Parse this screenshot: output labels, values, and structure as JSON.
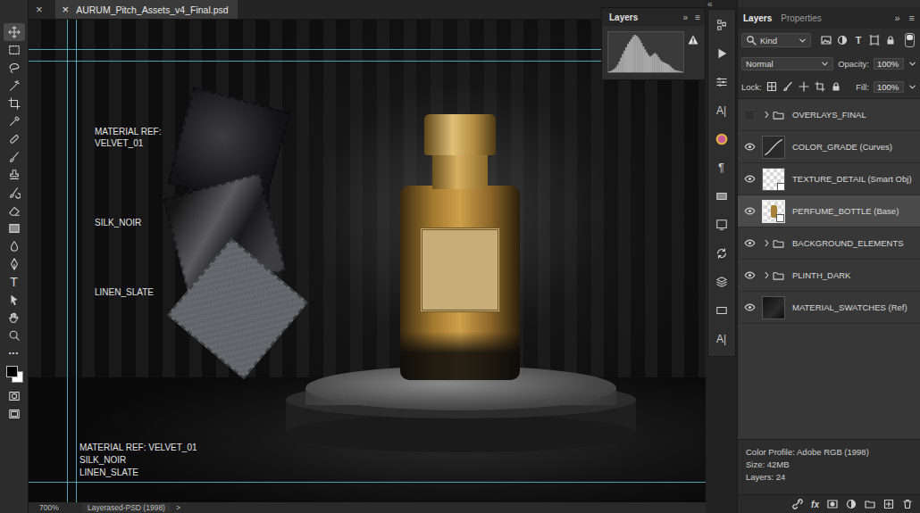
{
  "window": {
    "collapse_left": "«",
    "collapse_right": "»"
  },
  "document_tabs": [
    {
      "label": "",
      "close": "×",
      "selected": false
    },
    {
      "label": "AURUM_Pitch_Assets_v4_Final.psd",
      "close": "×",
      "selected": true
    }
  ],
  "tools": [
    {
      "selected": true,
      "glyph": ""
    },
    {
      "selected": false,
      "glyph": ""
    },
    {
      "selected": false,
      "glyph": ""
    },
    {
      "selected": false,
      "glyph": ""
    },
    {
      "selected": false,
      "glyph": ""
    },
    {
      "selected": false,
      "glyph": ""
    },
    {
      "selected": false,
      "glyph": ""
    },
    {
      "selected": false,
      "glyph": ""
    },
    {
      "selected": false,
      "glyph": ""
    },
    {
      "selected": false,
      "glyph": ""
    },
    {
      "selected": false,
      "glyph": ""
    },
    {
      "selected": false,
      "glyph": ""
    },
    {
      "selected": false,
      "glyph": ""
    },
    {
      "selected": false,
      "glyph": ""
    },
    {
      "selected": false,
      "glyph": "T"
    },
    {
      "selected": false,
      "glyph": ""
    },
    {
      "selected": false,
      "glyph": ""
    },
    {
      "selected": false,
      "glyph": ""
    },
    {
      "selected": false,
      "glyph": "•••"
    },
    {
      "selected": false,
      "glyph": ""
    },
    {
      "selected": false,
      "glyph": ""
    },
    {
      "selected": false,
      "glyph": ""
    }
  ],
  "canvas_labels": [
    {
      "lines": [
        "MATERIAL REF:",
        "VELVET_01"
      ]
    },
    {
      "lines": [
        "SILK_NOIR"
      ]
    },
    {
      "lines": [
        "LINEN_SLATE"
      ]
    }
  ],
  "canvas_note": {
    "lines": [
      "MATERIAL REF: VELVET_01",
      "SILK_NOIR",
      "LINEN_SLATE"
    ]
  },
  "status_bar": {
    "zoom": "700%",
    "info": "Layerased-PSD (1998)",
    "arrow": ">"
  },
  "histogram_panel": {
    "tab": "Layers",
    "expand": "»",
    "menu": "≡",
    "values": [
      2,
      3,
      5,
      8,
      12,
      18,
      26,
      35,
      44,
      52,
      60,
      68,
      74,
      80,
      86,
      90,
      88,
      84,
      78,
      70,
      62,
      55,
      48,
      42,
      38,
      40,
      44,
      46,
      42,
      36,
      30,
      26,
      24,
      22,
      20,
      18,
      14,
      10,
      7,
      5,
      4,
      3,
      2,
      1
    ]
  },
  "mid_tools": [
    "",
    "",
    "",
    "A|",
    "",
    "¶",
    "",
    "",
    "",
    "",
    "",
    "A|"
  ],
  "layers_panel": {
    "tabs": [
      {
        "label": "Layers",
        "selected": true
      },
      {
        "label": "Properties",
        "selected": false
      }
    ],
    "menu": "≡",
    "filter": {
      "label": "Kind",
      "glyphs": [
        "",
        "",
        "T",
        "",
        ""
      ]
    },
    "blend_mode": "Normal",
    "opacity_label": "Opacity:",
    "opacity": "100%",
    "lock_label": "Lock:",
    "fill_label": "Fill:",
    "fill": "100%",
    "layers": [
      {
        "name": "OVERLAYS_FINAL",
        "kind": "group",
        "visible": false,
        "expanded": false,
        "selected": false
      },
      {
        "name": "COLOR_GRADE (Curves)",
        "kind": "adjustment",
        "visible": true,
        "expanded": false,
        "selected": false
      },
      {
        "name": "TEXTURE_DETAIL (Smart Obj)",
        "kind": "smart",
        "visible": true,
        "expanded": false,
        "selected": false
      },
      {
        "name": "PERFUME_BOTTLE (Base)",
        "kind": "smart",
        "visible": true,
        "expanded": false,
        "selected": true
      },
      {
        "name": "BACKGROUND_ELEMENTS",
        "kind": "group",
        "visible": true,
        "expanded": false,
        "selected": false
      },
      {
        "name": "PLINTH_DARK",
        "kind": "group",
        "visible": true,
        "expanded": false,
        "selected": false
      },
      {
        "name": "MATERIAL_SWATCHES (Ref)",
        "kind": "pixel",
        "visible": true,
        "expanded": false,
        "selected": false
      }
    ],
    "info": [
      "Color Profile: Adobe RGB (1998)",
      "Size: 42MB",
      "Layers: 24"
    ],
    "footer_glyphs": [
      "",
      "fx",
      "",
      "",
      "",
      "",
      ""
    ]
  }
}
